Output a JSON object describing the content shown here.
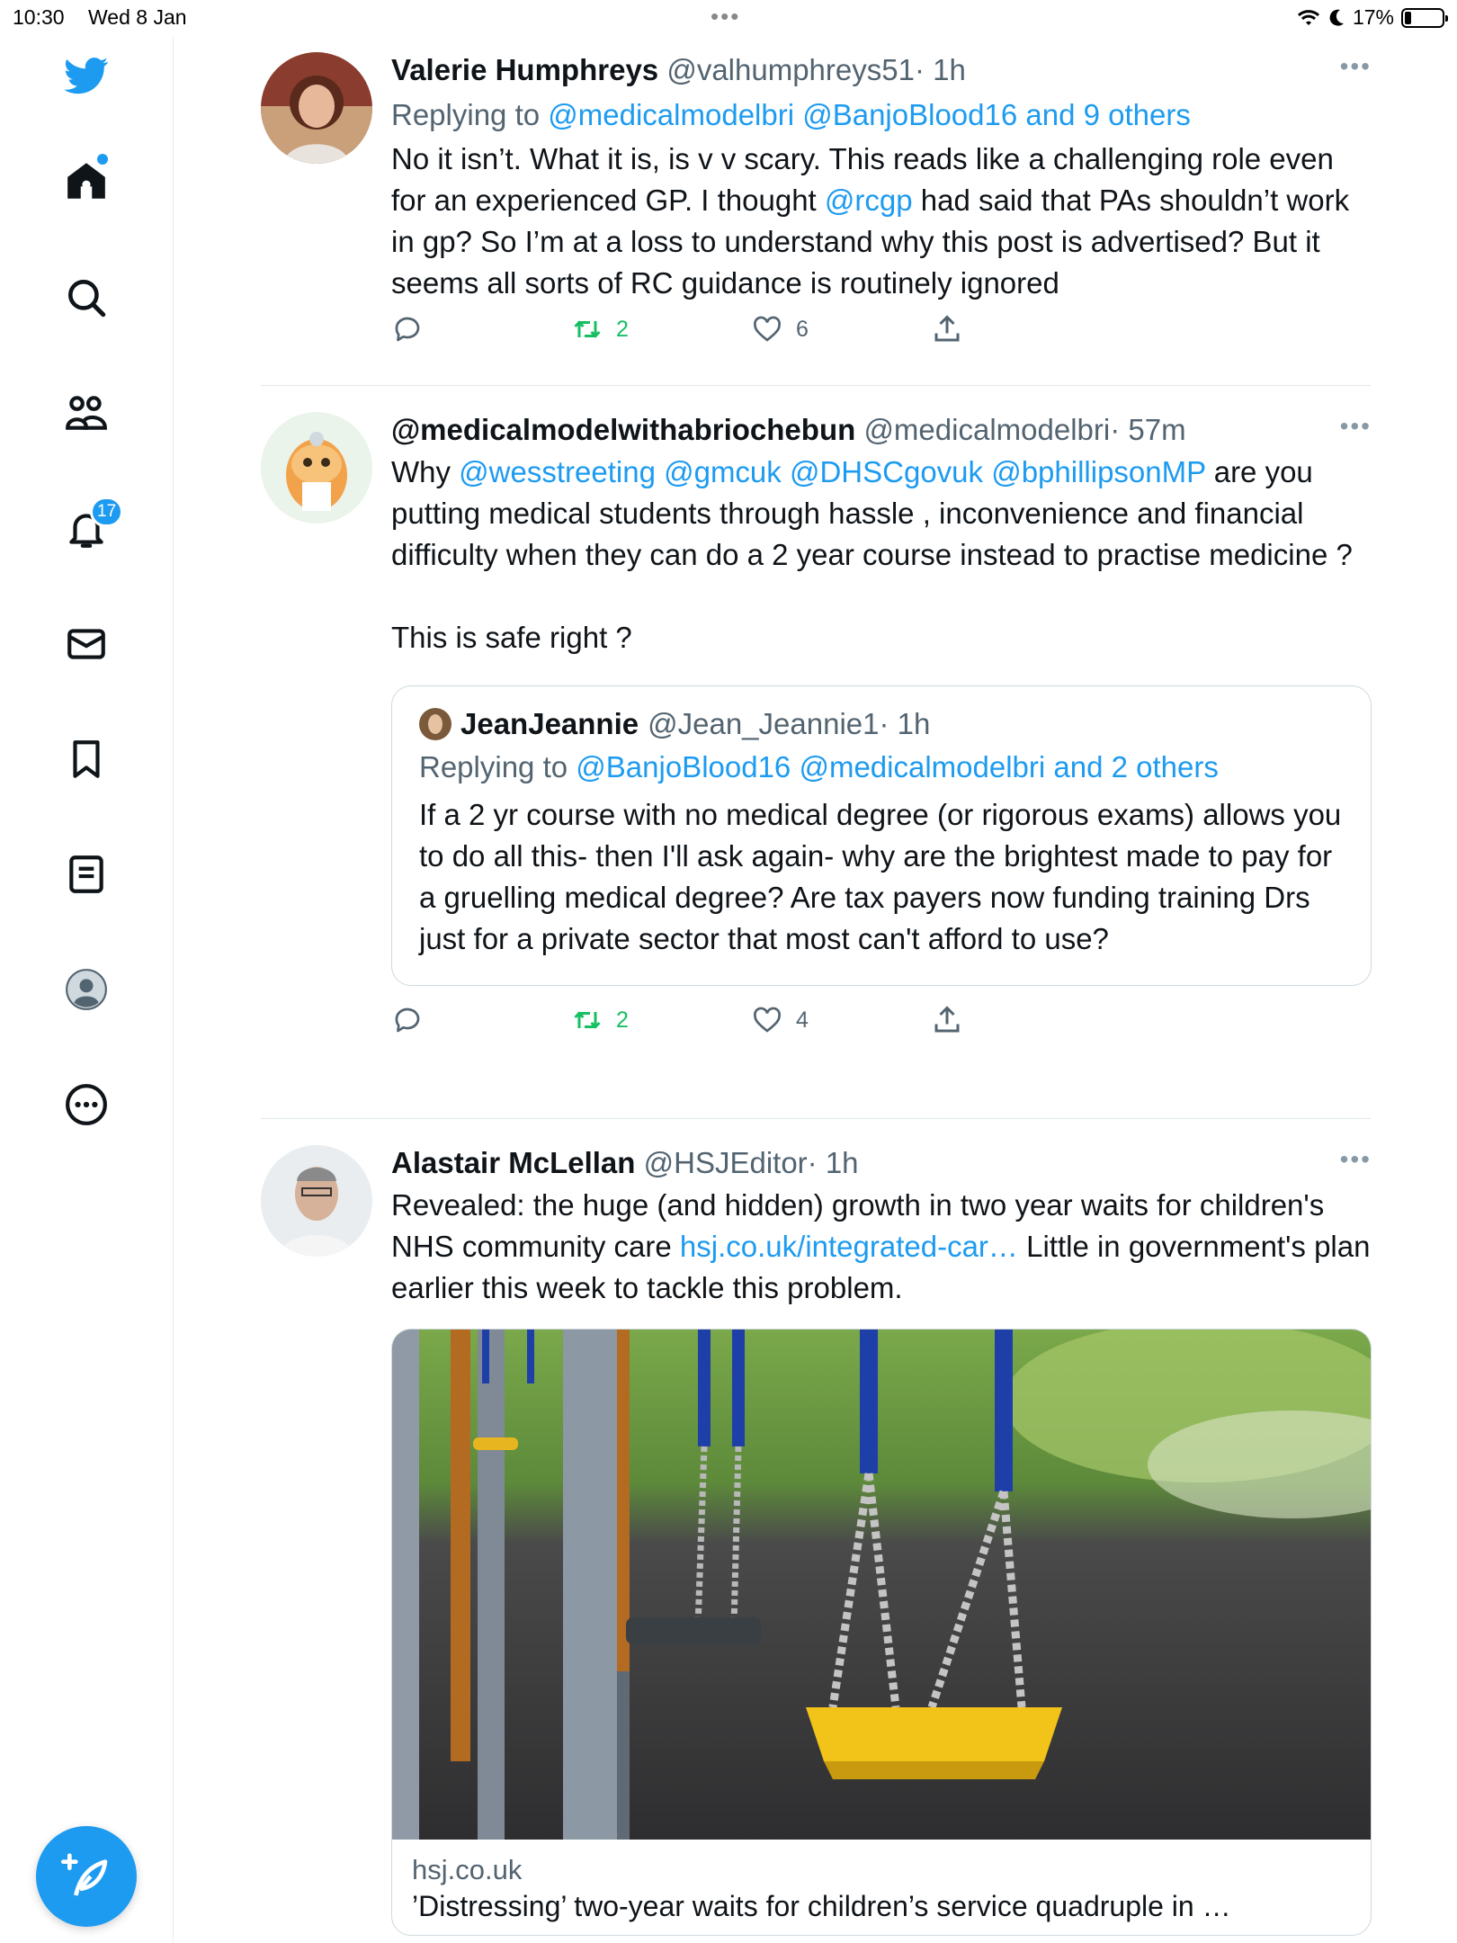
{
  "status_bar": {
    "time": "10:30",
    "date": "Wed 8 Jan",
    "dots": "•••",
    "battery": "17%",
    "battery_level": 0.17
  },
  "sidebar": {
    "notifications_badge": "17",
    "items": [
      {
        "name": "home"
      },
      {
        "name": "explore"
      },
      {
        "name": "communities"
      },
      {
        "name": "notifications"
      },
      {
        "name": "messages"
      },
      {
        "name": "bookmarks"
      },
      {
        "name": "lists"
      },
      {
        "name": "profile"
      },
      {
        "name": "more"
      }
    ]
  },
  "tweets": [
    {
      "name": "Valerie Humphreys",
      "handle": "@valhumphreys51",
      "time": "· 1h",
      "replying_prefix": "Replying to",
      "replying_links": "@medicalmodelbri @BanjoBlood16 and 9 others",
      "text_1": "No it isn’t. What it is, is v v scary. This reads like a challenging role even for an experienced GP. I thought ",
      "mention": "@rcgp",
      "text_2": " had said that PAs shouldn’t work in gp? So I’m at a loss to understand why this post is advertised? But it seems all sorts of RC guidance is routinely ignored",
      "retweets": "2",
      "likes": "6"
    },
    {
      "name": "@medicalmodelwithabriochebun",
      "handle": "@medicalmodelbri",
      "time": "· 57m",
      "text_prefix": "Why ",
      "mentions": "@wesstreeting @gmcuk @DHSCgovuk @bphillipsonMP",
      "text_rest": " are you putting medical students through hassle , inconvenience and financial difficulty when they can do a 2 year course instead to practise medicine ?",
      "text_second": "This is safe right ?",
      "quote": {
        "name": "JeanJeannie",
        "handle": "@Jean_Jeannie1",
        "time": "· 1h",
        "replying_prefix": "Replying to",
        "replying_links": "@BanjoBlood16 @medicalmodelbri and 2 others",
        "text": "If a 2 yr course with no medical degree (or rigorous exams) allows you to do all this- then I'll ask again- why are the brightest made to pay for a gruelling medical degree? Are tax payers now funding training Drs just for a private sector that most can't afford to use?"
      },
      "retweets": "2",
      "likes": "4"
    },
    {
      "name": "Alastair McLellan",
      "handle": "@HSJEditor",
      "time": "· 1h",
      "text_1": "Revealed: the huge (and hidden) growth in two year waits for children's NHS community care ",
      "link": "hsj.co.uk/integrated-car…",
      "text_2": " Little in government's plan earlier this week to tackle this problem.",
      "card": {
        "domain": "hsj.co.uk",
        "title": "’Distressing’ two-year waits for children’s service quadruple in …"
      }
    }
  ],
  "colors": {
    "accent": "#1d9bf0",
    "retweet": "#17bf63",
    "text": "#0f1419",
    "muted": "#536471"
  }
}
